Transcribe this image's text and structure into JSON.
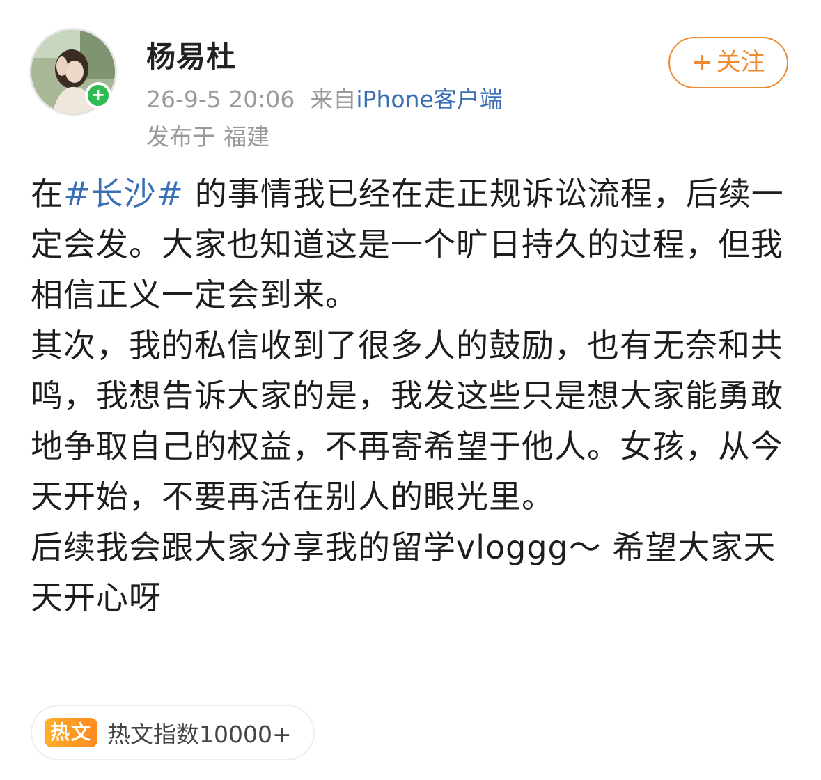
{
  "user": {
    "name": "杨易杜",
    "avatar": "avatar-photo",
    "badge_icon": "add-icon",
    "badge_glyph": "+"
  },
  "meta": {
    "time": "26-9-5 20:06",
    "source_prefix": "来自",
    "source_link": "iPhone客户端",
    "location_prefix": "发布于",
    "location": "福建"
  },
  "follow_button": {
    "icon_glyph": "+",
    "label": "关注",
    "color": "#f08a2e"
  },
  "body": {
    "line1_prefix": "在",
    "hashtag": "#长沙#",
    "line1_rest": " 的事情我已经在走正规诉讼流程，后续一定会发。大家也知道这是一个旷日持久的过程，但我相信正义一定会到来。",
    "para2": "其次，我的私信收到了很多人的鼓励，也有无奈和共鸣，我想告诉大家的是，我发这些只是想大家能勇敢地争取自己的权益，不再寄希望于他人。女孩，从今天开始，不要再活在别人的眼光里。",
    "para3": "后续我会跟大家分享我的留学vloggg～ 希望大家天天开心呀",
    "hashtag_color": "#3a6fb5"
  },
  "hot": {
    "tag": "热文",
    "text": "热文指数10000+",
    "tag_color": "#ff9a24"
  }
}
